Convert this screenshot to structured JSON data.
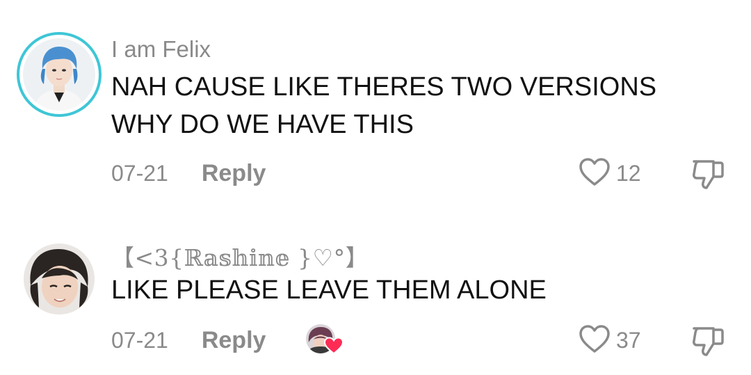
{
  "comments": [
    {
      "username": "I am Felix",
      "text": "NAH CAUSE LIKE THERES TWO VERSIONS\nWHY DO WE HAVE THIS",
      "date": "07-21",
      "reply_label": "Reply",
      "like_count": "12",
      "avatar_ring_color": "#3ec6d6"
    },
    {
      "username": "【<3{ℝ𝕒𝕤𝕙𝕚𝕟𝕖 }♡°】",
      "text": "LIKE PLEASE LEAVE THEM ALONE",
      "date": "07-21",
      "reply_label": "Reply",
      "like_count": "37",
      "creator_liked": true,
      "creator_heart_color": "#fe2c55"
    }
  ],
  "icons": {
    "like": "heart-outline-icon",
    "dislike": "thumbs-down-icon"
  },
  "colors": {
    "secondary_text": "#8a8a8a",
    "primary_text": "#111111"
  }
}
